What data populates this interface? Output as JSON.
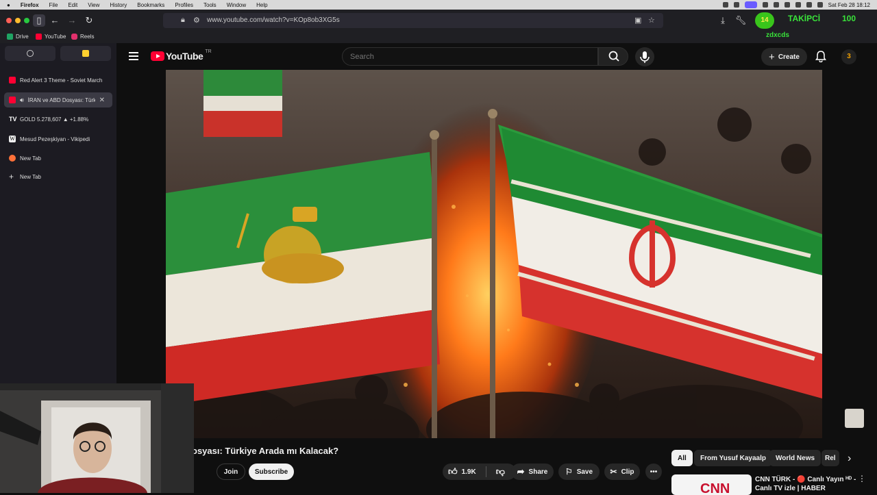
{
  "menubar": {
    "items": [
      "Firefox",
      "File",
      "Edit",
      "View",
      "History",
      "Bookmarks",
      "Profiles",
      "Tools",
      "Window",
      "Help"
    ],
    "clock": "Sat Feb 28  18:12"
  },
  "browser": {
    "url": "www.youtube.com/watch?v=KOp8ob3XG5s",
    "extension_badge": "14",
    "takipci_label": "TAKİPCİ",
    "takipci_count": "100",
    "overlay_text": "zdxcds"
  },
  "bookmarks": [
    {
      "label": "Drive",
      "color": "#1fa463"
    },
    {
      "label": "YouTube",
      "color": "#ff0033"
    },
    {
      "label": "Reels",
      "color": "#e1306c"
    }
  ],
  "sidebar_tabs": [
    {
      "label": "Red Alert 3 Theme - Soviet March",
      "icon": "youtube-favicon",
      "color": "#ff0033",
      "active": false
    },
    {
      "label": "İRAN ve ABD Dosyası: Türk",
      "icon": "youtube-favicon",
      "color": "#ff0033",
      "active": true
    },
    {
      "label": "GOLD 5.278,607 ▲ +1.88%",
      "icon": "tradingview-favicon",
      "color": "#ffffff",
      "active": false
    },
    {
      "label": "Mesud Pezeşkiyan - Vikipedi",
      "icon": "wikipedia-favicon",
      "color": "#dddddd",
      "active": false
    },
    {
      "label": "New Tab",
      "icon": "firefox-favicon",
      "color": "#ff7139",
      "active": false
    },
    {
      "label": "New Tab",
      "icon": "plus-icon",
      "color": "#dddddd",
      "active": false
    }
  ],
  "youtube": {
    "logo_text": "YouTube",
    "country_code": "TR",
    "search_placeholder": "Search",
    "create_label": "Create",
    "avatar_letter": "3",
    "video_title": "osyası: Türkiye Arada mı Kalacak?",
    "join_label": "Join",
    "subscribe_label": "Subscribe",
    "like_count": "1.9K",
    "share_label": "Share",
    "save_label": "Save",
    "clip_label": "Clip",
    "chips": [
      "All",
      "From Yusuf Kayaalp",
      "World News",
      "Rel"
    ],
    "recommendation_title": "CNN TÜRK - 🔴 Canlı Yayın ᴴᴰ - Canlı TV izle | HABER",
    "recommendation_thumb_text": "CNN"
  },
  "colors": {
    "youtube_red": "#ff0033",
    "takipci_green": "#39e33a",
    "menubar_selected": "#6a5cff"
  }
}
